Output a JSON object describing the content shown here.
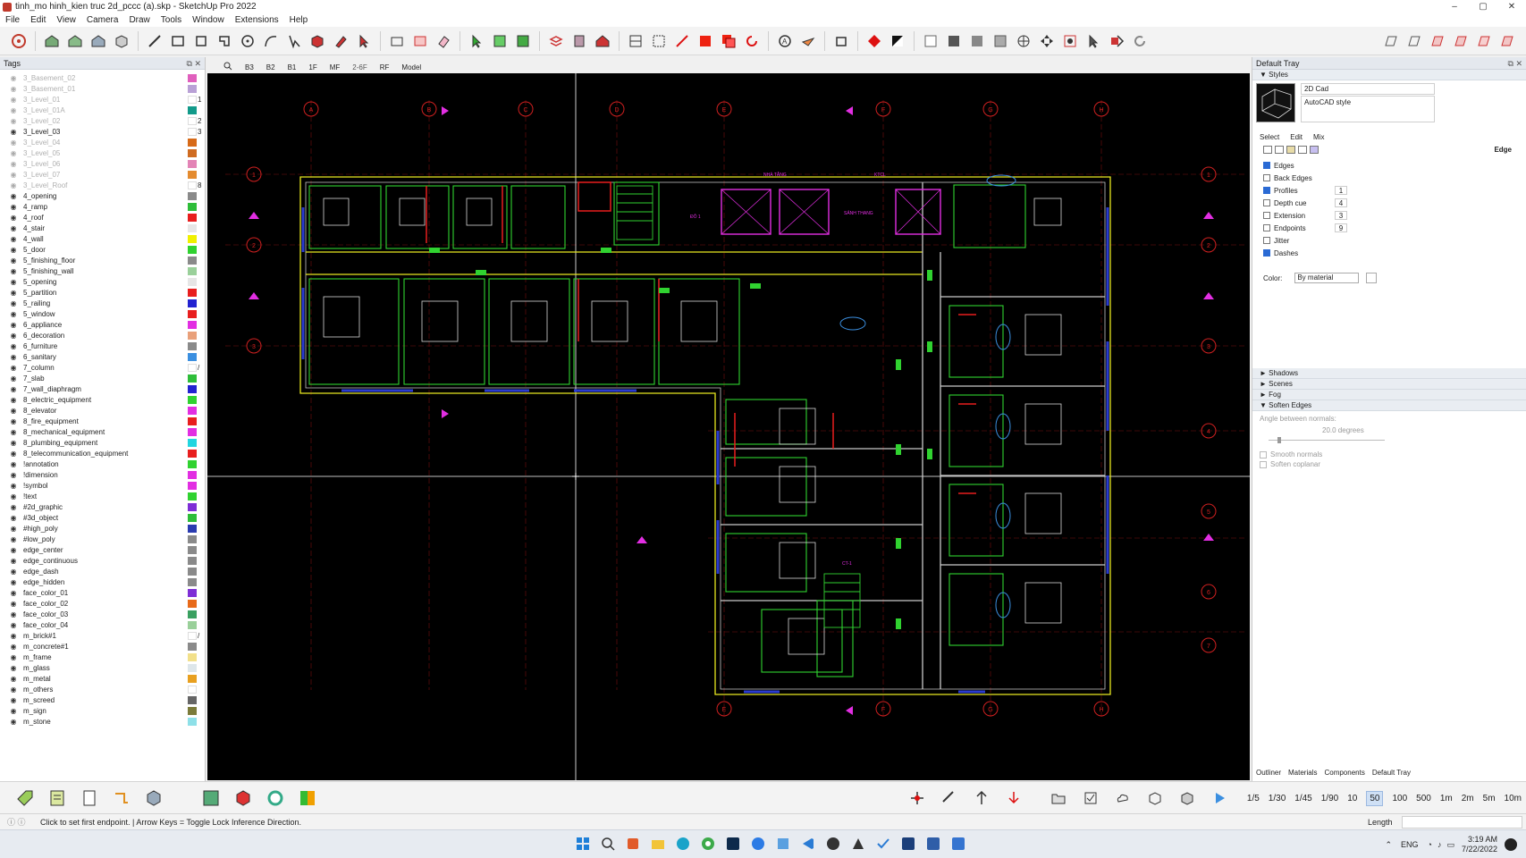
{
  "window": {
    "title": "tinh_mo hinh_kien truc 2d_pccc (a).skp - SketchUp Pro 2022",
    "controls": [
      "–",
      "▢",
      "✕"
    ]
  },
  "menu": [
    "File",
    "Edit",
    "View",
    "Camera",
    "Draw",
    "Tools",
    "Window",
    "Extensions",
    "Help"
  ],
  "tags_panel": {
    "title": "Tags",
    "header_icons": "⧉ ✕",
    "items": [
      {
        "name": "3_Basement_02",
        "visible": false,
        "color": "#e05fbd",
        "mark": ""
      },
      {
        "name": "3_Basement_01",
        "visible": false,
        "color": "#b9a1d6",
        "mark": ""
      },
      {
        "name": "3_Level_01",
        "visible": false,
        "color": "#ffffff",
        "mark": "1"
      },
      {
        "name": "3_Level_01A",
        "visible": false,
        "color": "#129a8a",
        "mark": ""
      },
      {
        "name": "3_Level_02",
        "visible": false,
        "color": "#ffffff",
        "mark": "2"
      },
      {
        "name": "3_Level_03",
        "visible": true,
        "color": "#ffffff",
        "mark": "3"
      },
      {
        "name": "3_Level_04",
        "visible": false,
        "color": "#d76a18",
        "mark": ""
      },
      {
        "name": "3_Level_05",
        "visible": false,
        "color": "#cf6b21",
        "mark": ""
      },
      {
        "name": "3_Level_06",
        "visible": false,
        "color": "#e384b6",
        "mark": ""
      },
      {
        "name": "3_Level_07",
        "visible": false,
        "color": "#e48b2f",
        "mark": ""
      },
      {
        "name": "3_Level_Roof",
        "visible": false,
        "color": "#ffffff",
        "mark": "8"
      },
      {
        "name": "4_opening",
        "visible": true,
        "color": "#8a8a8a",
        "mark": ""
      },
      {
        "name": "4_ramp",
        "visible": true,
        "color": "#2ebd39",
        "mark": ""
      },
      {
        "name": "4_roof",
        "visible": true,
        "color": "#e81e1e",
        "mark": ""
      },
      {
        "name": "4_stair",
        "visible": true,
        "color": "#e6e6e6",
        "mark": ""
      },
      {
        "name": "4_wall",
        "visible": true,
        "color": "#f0f000",
        "mark": ""
      },
      {
        "name": "5_door",
        "visible": true,
        "color": "#30d230",
        "mark": ""
      },
      {
        "name": "5_finishing_floor",
        "visible": true,
        "color": "#8a8a8a",
        "mark": ""
      },
      {
        "name": "5_finishing_wall",
        "visible": true,
        "color": "#9ad09a",
        "mark": ""
      },
      {
        "name": "5_opening",
        "visible": true,
        "color": "#e6e6e6",
        "mark": ""
      },
      {
        "name": "5_partition",
        "visible": true,
        "color": "#e81e1e",
        "mark": ""
      },
      {
        "name": "5_railing",
        "visible": true,
        "color": "#2222d0",
        "mark": ""
      },
      {
        "name": "5_window",
        "visible": true,
        "color": "#e81e1e",
        "mark": ""
      },
      {
        "name": "6_appliance",
        "visible": true,
        "color": "#e22ee2",
        "mark": ""
      },
      {
        "name": "6_decoration",
        "visible": true,
        "color": "#e9a07a",
        "mark": ""
      },
      {
        "name": "6_furniture",
        "visible": true,
        "color": "#8a8a8a",
        "mark": ""
      },
      {
        "name": "6_sanitary",
        "visible": true,
        "color": "#3b8fe0",
        "mark": ""
      },
      {
        "name": "7_column",
        "visible": true,
        "color": "#ffffff",
        "mark": "/"
      },
      {
        "name": "7_slab",
        "visible": true,
        "color": "#2ebd39",
        "mark": ""
      },
      {
        "name": "7_wall_diaphragm",
        "visible": true,
        "color": "#2222d0",
        "mark": ""
      },
      {
        "name": "8_electric_equipment",
        "visible": true,
        "color": "#30d230",
        "mark": ""
      },
      {
        "name": "8_elevator",
        "visible": true,
        "color": "#e22ee2",
        "mark": ""
      },
      {
        "name": "8_fire_equipment",
        "visible": true,
        "color": "#e81e1e",
        "mark": ""
      },
      {
        "name": "8_mechanical_equipment",
        "visible": true,
        "color": "#e22ee2",
        "mark": ""
      },
      {
        "name": "8_plumbing_equipment",
        "visible": true,
        "color": "#22d6e0",
        "mark": ""
      },
      {
        "name": "8_telecommunication_equipment",
        "visible": true,
        "color": "#e81e1e",
        "mark": ""
      },
      {
        "name": "!annotation",
        "visible": true,
        "color": "#30d230",
        "mark": ""
      },
      {
        "name": "!dimension",
        "visible": true,
        "color": "#e22ee2",
        "mark": ""
      },
      {
        "name": "!symbol",
        "visible": true,
        "color": "#e22ee2",
        "mark": ""
      },
      {
        "name": "!text",
        "visible": true,
        "color": "#30d230",
        "mark": ""
      },
      {
        "name": "#2d_graphic",
        "visible": true,
        "color": "#7e2ed6",
        "mark": ""
      },
      {
        "name": "#3d_object",
        "visible": true,
        "color": "#2ebd39",
        "mark": ""
      },
      {
        "name": "#high_poly",
        "visible": true,
        "color": "#2a3bb0",
        "mark": ""
      },
      {
        "name": "#low_poly",
        "visible": true,
        "color": "#8a8a8a",
        "mark": ""
      },
      {
        "name": "edge_center",
        "visible": true,
        "color": "#8a8a8a",
        "mark": ""
      },
      {
        "name": "edge_continuous",
        "visible": true,
        "color": "#8a8a8a",
        "mark": ""
      },
      {
        "name": "edge_dash",
        "visible": true,
        "color": "#8a8a8a",
        "mark": ""
      },
      {
        "name": "edge_hidden",
        "visible": true,
        "color": "#8a8a8a",
        "mark": ""
      },
      {
        "name": "face_color_01",
        "visible": true,
        "color": "#7e2ed6",
        "mark": ""
      },
      {
        "name": "face_color_02",
        "visible": true,
        "color": "#e86a1a",
        "mark": ""
      },
      {
        "name": "face_color_03",
        "visible": true,
        "color": "#3aa060",
        "mark": ""
      },
      {
        "name": "face_color_04",
        "visible": true,
        "color": "#9ad09a",
        "mark": ""
      },
      {
        "name": "m_brick#1",
        "visible": true,
        "color": "#ffffff",
        "mark": "/"
      },
      {
        "name": "m_concrete#1",
        "visible": true,
        "color": "#8a8a8a",
        "mark": ""
      },
      {
        "name": "m_frame",
        "visible": true,
        "color": "#f2e08a",
        "mark": ""
      },
      {
        "name": "m_glass",
        "visible": true,
        "color": "#dde6ea",
        "mark": ""
      },
      {
        "name": "m_metal",
        "visible": true,
        "color": "#e8a020",
        "mark": ""
      },
      {
        "name": "m_others",
        "visible": true,
        "color": "#ffffff",
        "mark": ""
      },
      {
        "name": "m_screed",
        "visible": true,
        "color": "#666666",
        "mark": ""
      },
      {
        "name": "m_sign",
        "visible": true,
        "color": "#7b7b3a",
        "mark": ""
      },
      {
        "name": "m_stone",
        "visible": true,
        "color": "#8ee0e8",
        "mark": ""
      }
    ]
  },
  "scene_tabs": {
    "items": [
      "B3",
      "B2",
      "B1",
      "1F",
      "MF",
      "2-6F",
      "RF",
      "Model"
    ],
    "active": "2-6F"
  },
  "viewport": {
    "grid_markers_top": [
      "A",
      "B",
      "C",
      "D",
      "E",
      "F",
      "G",
      "H"
    ],
    "grid_markers_bottom": [
      "E",
      "F",
      "G",
      "H"
    ],
    "grid_markers_left": [
      "1",
      "2",
      "3"
    ],
    "grid_markers_right": [
      "1",
      "2",
      "3",
      "4",
      "5",
      "6",
      "7"
    ],
    "room_labels": [
      "SẢNH THANG",
      "KTCL",
      "NHÀ TẮNG",
      "ĐÔ 1",
      "CT-1"
    ]
  },
  "tray": {
    "title": "Default Tray",
    "header_icons": "⧉ ✕",
    "styles_section": "Styles",
    "style_name": "2D Cad",
    "style_description": "AutoCAD style",
    "tabs": [
      "Select",
      "Edit",
      "Mix"
    ],
    "edge_label": "Edge",
    "edge_settings": [
      {
        "label": "Edges",
        "checked": true,
        "value": ""
      },
      {
        "label": "Back Edges",
        "checked": false,
        "value": ""
      },
      {
        "label": "Profiles",
        "checked": true,
        "value": "1"
      },
      {
        "label": "Depth cue",
        "checked": false,
        "value": "4"
      },
      {
        "label": "Extension",
        "checked": false,
        "value": "3"
      },
      {
        "label": "Endpoints",
        "checked": false,
        "value": "9"
      },
      {
        "label": "Jitter",
        "checked": false,
        "value": ""
      },
      {
        "label": "Dashes",
        "checked": true,
        "value": ""
      }
    ],
    "color_label": "Color:",
    "color_value": "By material",
    "collapsed_sections": [
      "Shadows",
      "Scenes",
      "Fog"
    ],
    "soften_edges": {
      "title": "Soften Edges",
      "angle_label": "Angle between normals:",
      "angle_value": "20.0 degrees",
      "smooth_normals": "Smooth normals",
      "soften_coplanar": "Soften coplanar"
    },
    "bottom_tabs": [
      "Outliner",
      "Materials",
      "Components",
      "Default Tray"
    ]
  },
  "bottom_toolbar": {
    "scales": [
      "1/5",
      "1/30",
      "1/45",
      "1/90",
      "10",
      "50",
      "100",
      "500",
      "1m",
      "2m",
      "5m",
      "10m"
    ],
    "active_scale": "50"
  },
  "status": {
    "text": "Click to set first endpoint. | Arrow Keys = Toggle Lock Inference Direction.",
    "measurement_label": "Length"
  },
  "taskbar": {
    "language": "ENG",
    "time": "3:19 AM",
    "date": "7/22/2022"
  }
}
